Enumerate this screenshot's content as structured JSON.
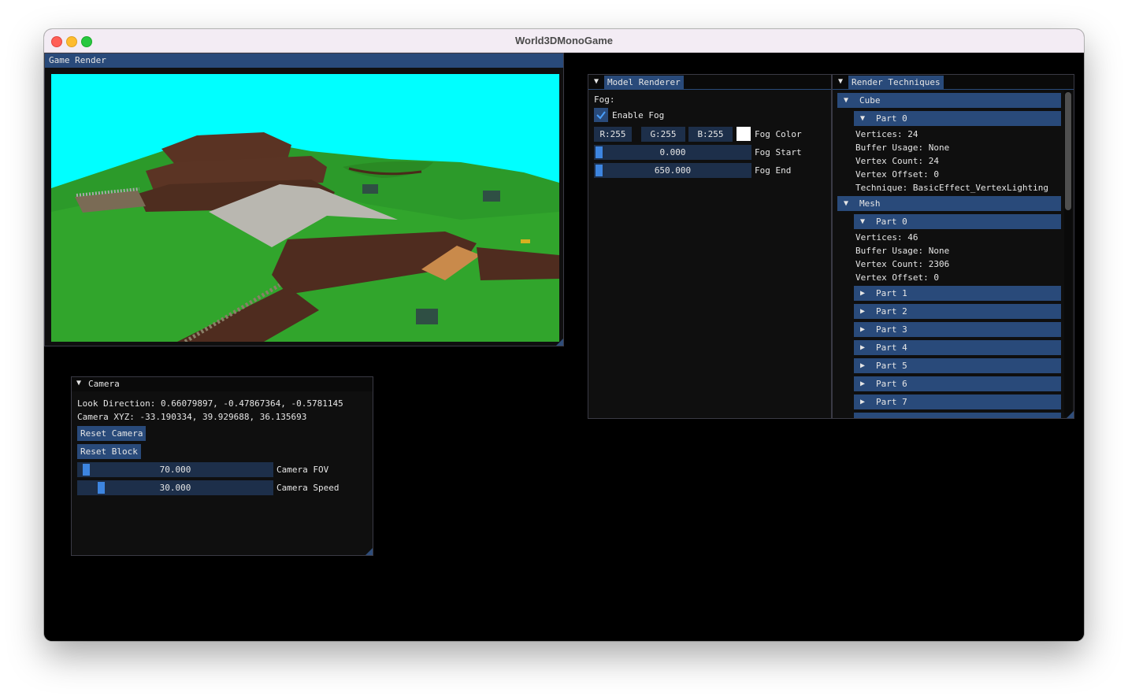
{
  "window": {
    "title": "World3DMonoGame"
  },
  "game_render": {
    "title": "Game Render"
  },
  "camera": {
    "title": "Camera",
    "look_direction": "Look Direction: 0.66079897, -0.47867364, -0.5781145",
    "camera_xyz": "Camera XYZ: -33.190334, 39.929688, 36.135693",
    "reset_camera": "Reset Camera",
    "reset_block": "Reset Block",
    "fov": {
      "value": "70.000",
      "label": "Camera FOV",
      "fraction": 0.02
    },
    "speed": {
      "value": "30.000",
      "label": "Camera Speed",
      "fraction": 0.1
    }
  },
  "model_renderer": {
    "title": "Model Renderer",
    "fog_label": "Fog:",
    "enable_fog": "Enable Fog",
    "enable_fog_checked": true,
    "r": "R:255",
    "g": "G:255",
    "b": "B:255",
    "fog_color_label": "Fog Color",
    "fog_color": "#ffffff",
    "fog_start": {
      "value": "0.000",
      "label": "Fog Start",
      "fraction": 0.0
    },
    "fog_end": {
      "value": "650.000",
      "label": "Fog End",
      "fraction": 0.0
    }
  },
  "render_techniques": {
    "title": "Render Techniques",
    "cube": {
      "label": "Cube",
      "part0_label": "Part 0",
      "vertices": "Vertices: 24",
      "buffer_usage": "Buffer Usage: None",
      "vertex_count": "Vertex Count: 24",
      "vertex_offset": "Vertex Offset: 0",
      "technique": "Technique: BasicEffect_VertexLighting"
    },
    "mesh": {
      "label": "Mesh",
      "part0_label": "Part 0",
      "vertices": "Vertices: 46",
      "buffer_usage": "Buffer Usage: None",
      "vertex_count": "Vertex Count: 2306",
      "vertex_offset": "Vertex Offset: 0",
      "collapsed_parts": [
        "Part 1",
        "Part 2",
        "Part 3",
        "Part 4",
        "Part 5",
        "Part 6",
        "Part 7"
      ]
    }
  },
  "colors": {
    "accent": "#294a7a",
    "slider_grab": "#3d85e0",
    "sky": "#00ffff",
    "grass": "#2e9e2a"
  }
}
